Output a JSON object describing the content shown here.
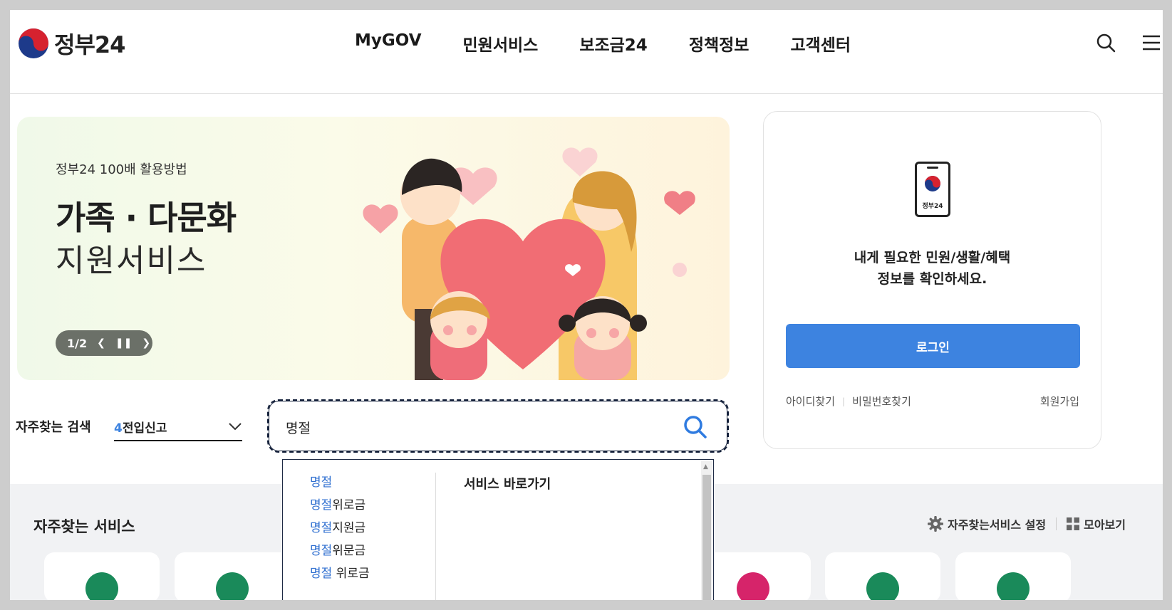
{
  "header": {
    "logo_text": "정부24",
    "nav": [
      "MyGOV",
      "민원서비스",
      "보조금24",
      "정책정보",
      "고객센터"
    ]
  },
  "banner": {
    "subtitle": "정부24 100배 활용방법",
    "title": "가족 · 다문화",
    "title2": "지원서비스",
    "counter": "1/2"
  },
  "login": {
    "phone_label": "정부24",
    "message_line1": "내게 필요한 민원/생활/혜택",
    "message_line2": "정보를 확인하세요.",
    "button": "로그인",
    "find_id": "아이디찾기",
    "find_pw": "비밀번호찾기",
    "signup": "회원가입"
  },
  "search": {
    "freq_label": "자주찾는 검색",
    "freq_num": "4",
    "freq_text": "전입신고",
    "query": "명절"
  },
  "autocomplete": {
    "items": [
      {
        "hl": "명절",
        "rest": ""
      },
      {
        "hl": "명절",
        "rest": "위로금"
      },
      {
        "hl": "명절",
        "rest": "지원금"
      },
      {
        "hl": "명절",
        "rest": "위문금"
      },
      {
        "hl": "명절",
        "rest": " 위로금"
      }
    ],
    "right_title": "서비스 바로가기"
  },
  "frequent_services": {
    "title": "자주찾는 서비스",
    "settings": "자주찾는서비스 설정",
    "view_all": "모아보기"
  },
  "colors": {
    "accent": "#3d83e0",
    "highlight": "#2f6fd0"
  }
}
